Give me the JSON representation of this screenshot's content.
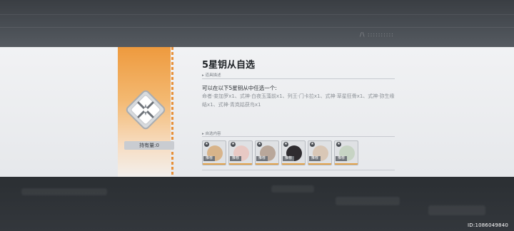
{
  "background": {
    "mark": "/\\ ::::::::::"
  },
  "item": {
    "icon": "five-star-key-icon",
    "hold_label": "持有量:0",
    "accent_color": "#ee9a3e"
  },
  "detail": {
    "title": "5星钥从自选",
    "desc_section_label": "道具描述",
    "desc_line1": "可以在以下5星钥从中任选一个:",
    "desc_line2": "命者·妾加罗x1、式神·白夜玉藻前x1、列王·门卡拉x1、式神·草星狂骨x1、式神·弥生缘结x1、式神·青岚姑获鸟x1",
    "choices_section_label": "自选内容",
    "choices": [
      {
        "tag": "推荐",
        "color": "#d8b48a",
        "star": "★"
      },
      {
        "tag": "推荐",
        "color": "#e8c9c4",
        "star": "★"
      },
      {
        "tag": "推荐",
        "color": "#b9a79a",
        "star": "★"
      },
      {
        "tag": "推荐",
        "color": "#2f2c30",
        "star": "★"
      },
      {
        "tag": "推荐",
        "color": "#d9c7b6",
        "star": "★"
      },
      {
        "tag": "推荐",
        "color": "#c7d4c4",
        "star": "★"
      }
    ]
  },
  "watermark": "ID:1086049840"
}
